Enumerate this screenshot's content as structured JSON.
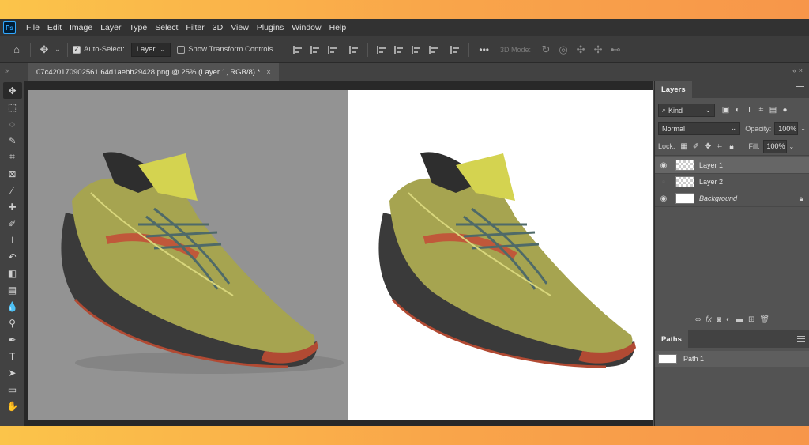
{
  "app": {
    "logo": "Ps"
  },
  "menu": [
    "File",
    "Edit",
    "Image",
    "Layer",
    "Type",
    "Select",
    "Filter",
    "3D",
    "View",
    "Plugins",
    "Window",
    "Help"
  ],
  "options": {
    "auto_select_label": "Auto-Select:",
    "auto_select_checked": true,
    "auto_select_target": "Layer",
    "show_transform_label": "Show Transform Controls",
    "show_transform_checked": false,
    "more": "•••",
    "mode_3d": "3D Mode:"
  },
  "document": {
    "tab_title": "07c420170902561.64d1aebb29428.png @ 25% (Layer 1, RGB/8) *",
    "close_glyph": "×"
  },
  "layers_panel": {
    "tab": "Layers",
    "filter_kind": "Kind",
    "blend_mode": "Normal",
    "opacity_label": "Opacity:",
    "opacity_value": "100%",
    "lock_label": "Lock:",
    "fill_label": "Fill:",
    "fill_value": "100%",
    "layers": [
      {
        "name": "Layer 1",
        "visible": true,
        "selected": true
      },
      {
        "name": "Layer 2",
        "visible": false,
        "selected": false
      },
      {
        "name": "Background",
        "visible": true,
        "selected": false,
        "locked": true
      }
    ],
    "footer_fx": "fx"
  },
  "paths_panel": {
    "tab": "Paths",
    "paths": [
      {
        "name": "Path 1"
      }
    ]
  },
  "colors": {
    "shoe_upper": "#a6a450",
    "shoe_sole": "#3a3a3a",
    "shoe_accent": "#c0583a",
    "laces": "#4f6a68"
  }
}
